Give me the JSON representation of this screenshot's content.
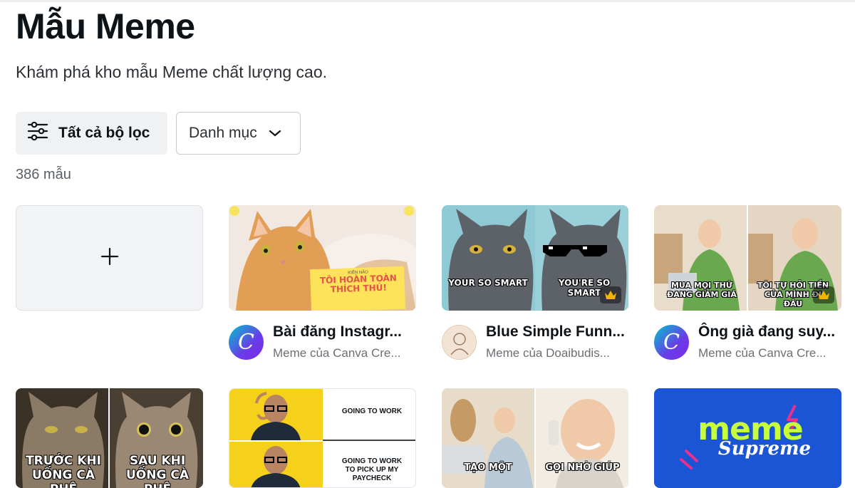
{
  "page": {
    "title": "Mẫu Meme",
    "subtitle": "Khám phá kho mẫu Meme chất lượng cao.",
    "filter_button": "Tất cả bộ lọc",
    "category_button": "Danh mục",
    "count": "386 mẫu"
  },
  "templates": [
    {
      "name": "Bài đăng Instagr...",
      "author": "Meme của Canva Cre...",
      "overlay_title": "TÔI HOÀN TOÀN THÍCH THÚ!",
      "overlay_kicker": "KIẾN NĂO",
      "premium": false
    },
    {
      "name": "Blue Simple Funn...",
      "author": "Meme của Doaibudis...",
      "caption_left": "YOUR SO SMART",
      "caption_right": "YOU'RE SO SMART",
      "premium": true
    },
    {
      "name": "Ông già đang suy...",
      "author": "Meme của Canva Cre...",
      "caption_left": "MUA MỌI THỨ ĐANG GIẢM GIÁ",
      "caption_right": "TÔI TỰ HỎI TIỀN CỦA MÌNH ĐI ĐÂU",
      "premium": true
    }
  ],
  "row2": [
    {
      "caption_left": "TRƯỚC KHI UỐNG CÀ PHÊ",
      "caption_right": "SAU KHI UỐNG CÀ PHÊ"
    },
    {
      "text_top": "GOING TO WORK",
      "text_bottom": "GOING TO WORK TO PICK UP MY PAYCHECK"
    },
    {
      "caption_left": "TẠO MỘT",
      "caption_right": "GỌI NHỜ GIÚP"
    },
    {
      "logo_line1": "meme",
      "logo_line2": "Supreme"
    }
  ],
  "icons": {
    "filter": "sliders-icon",
    "chevron": "chevron-down-icon",
    "plus": "plus-icon",
    "crown": "crown-icon"
  },
  "colors": {
    "canva_gradient_start": "#00c4cc",
    "canva_gradient_end": "#7d2ae8",
    "crown": "#f4b400",
    "supreme_bg": "#1a55d6",
    "supreme_text": "#c8ff3c"
  }
}
